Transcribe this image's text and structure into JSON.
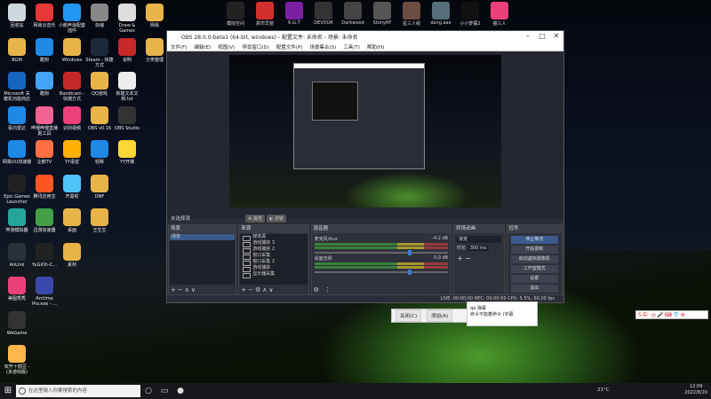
{
  "desktop": {
    "icons": [
      {
        "label": "回收站",
        "color": "#cfd8dc"
      },
      {
        "label": "网易云音乐",
        "color": "#e53935"
      },
      {
        "label": "小鹅声浪配套插件",
        "color": "#2196f3"
      },
      {
        "label": "剑魂",
        "color": "#888"
      },
      {
        "label": "Draw & Games",
        "color": "#ddd"
      },
      {
        "label": "网易",
        "color": "#e8b44a"
      },
      {
        "label": "BGM",
        "color": "#e8b44a"
      },
      {
        "label": "酷狗",
        "color": "#1e88e5"
      },
      {
        "label": "Windows",
        "color": "#e8b44a"
      },
      {
        "label": "Steam - 快捷方式",
        "color": "#1b2838"
      },
      {
        "label": "说明",
        "color": "#c62828"
      },
      {
        "label": "分类整理",
        "color": "#e8b44a"
      },
      {
        "label": "Microsoft 关键机功能商店",
        "color": "#1565c0"
      },
      {
        "label": "酷狗",
        "color": "#42a5f5"
      },
      {
        "label": "Bandicam - 快捷方式",
        "color": "#c62828"
      },
      {
        "label": "QQ游戏",
        "color": "#e8b44a"
      },
      {
        "label": "新建文本文档.txt",
        "color": "#eee"
      },
      {
        "label": "看向雷达",
        "color": "#1e88e5"
      },
      {
        "label": "哔哩哔哩直播姬工具",
        "color": "#f06292"
      },
      {
        "label": "识别视频",
        "color": "#ec407a"
      },
      {
        "label": "OBS v0.16",
        "color": "#e8b44a"
      },
      {
        "label": "OBS Studio",
        "color": "#333"
      },
      {
        "label": "网易UU加速器",
        "color": "#1e88e5"
      },
      {
        "label": "企鹅TV",
        "color": "#ff7043"
      },
      {
        "label": "YY语音",
        "color": "#ffb300"
      },
      {
        "label": "轻眸",
        "color": "#1e88e5"
      },
      {
        "label": "YY开播",
        "color": "#fdd835"
      },
      {
        "label": "Epic Games Launcher",
        "color": "#222"
      },
      {
        "label": "腾讯应用宝",
        "color": "#ff5722"
      },
      {
        "label": "开黑啦",
        "color": "#4fc3f7"
      },
      {
        "label": "DNF",
        "color": "#e8b44a"
      },
      {
        "label": "奔驰模拟器",
        "color": "#26a69a"
      },
      {
        "label": "迅游加速器",
        "color": "#43a047"
      },
      {
        "label": "桌面",
        "color": "#e8b44a"
      },
      {
        "label": "王生生",
        "color": "#e8b44a"
      },
      {
        "label": "AnLink",
        "color": "#263238"
      },
      {
        "label": "YuGiOh-C...",
        "color": "#222"
      },
      {
        "label": "素材",
        "color": "#e8b44a"
      },
      {
        "label": "美图秀秀",
        "color": "#ec407a"
      },
      {
        "label": "Arctime Pro.exe - ...",
        "color": "#3949ab"
      },
      {
        "label": "WeGame",
        "color": "#333"
      },
      {
        "label": "双开十鸽豆 -(多游戏版)",
        "color": "#ffb74d"
      }
    ],
    "top_icons": [
      {
        "label": "模拟空间",
        "color": "#222"
      },
      {
        "label": "高市早苗",
        "color": "#d32f2f"
      },
      {
        "label": "K.G.T",
        "color": "#7b1fa2"
      },
      {
        "label": "DEVOUR",
        "color": "#333"
      },
      {
        "label": "Darkwood",
        "color": "#444"
      },
      {
        "label": "StonyRF",
        "color": "#555"
      },
      {
        "label": "星三人组",
        "color": "#6d4c41"
      },
      {
        "label": "dang.aae",
        "color": "#546e7a"
      },
      {
        "label": "小小梦魇2",
        "color": "#111"
      },
      {
        "label": "猫三人",
        "color": "#ec407a"
      }
    ]
  },
  "obs": {
    "title": "OBS 28.0.0-beta1 (64-bit, windows) - 配置文件: 未命名 - 场景: 未命名",
    "menu": [
      "文件(F)",
      "编辑(E)",
      "视图(V)",
      "停靠窗口(D)",
      "配置文件(P)",
      "场景集合(S)",
      "工具(T)",
      "帮助(H)"
    ],
    "no_source": "未选择源",
    "props_btn": "属性",
    "filter_btn": "滤镜",
    "docks": {
      "scenes": {
        "title": "场景",
        "items": [
          "场景"
        ]
      },
      "sources": {
        "title": "来源",
        "items": [
          "媒体源",
          "游戏捕获 3",
          "游戏捕获 2",
          "窗口采集",
          "窗口采集 2",
          "游戏捕获",
          "显示器采集"
        ]
      },
      "mixer": {
        "title": "混音器",
        "channels": [
          {
            "name": "麦克风/Aux",
            "db": "-4.2 dB"
          },
          {
            "name": "桌面音频",
            "db": "0.0 dB"
          }
        ]
      },
      "transitions": {
        "title": "转场动画",
        "type": "渐变",
        "duration_label": "时长",
        "duration": "300 ms"
      },
      "controls": {
        "title": "控件",
        "buttons": [
          "停止推流",
          "开始录制",
          "启动虚拟摄像机",
          "工作室模式",
          "设置",
          "退出"
        ]
      }
    },
    "status": "LIVE: 00:00:00    REC: 00:00:00    CPU: 5.5%, 60.00 fps"
  },
  "float": {
    "close": "关闭(C)",
    "apply": "添加(A)"
  },
  "notif": {
    "title": "qq 弹幕",
    "text": "命令不能着命令 (字幕"
  },
  "taskbar": {
    "search_placeholder": "在这里输入你要搜索的内容",
    "temp": "21°C",
    "time": "12:09",
    "date": "2022/8/20"
  }
}
